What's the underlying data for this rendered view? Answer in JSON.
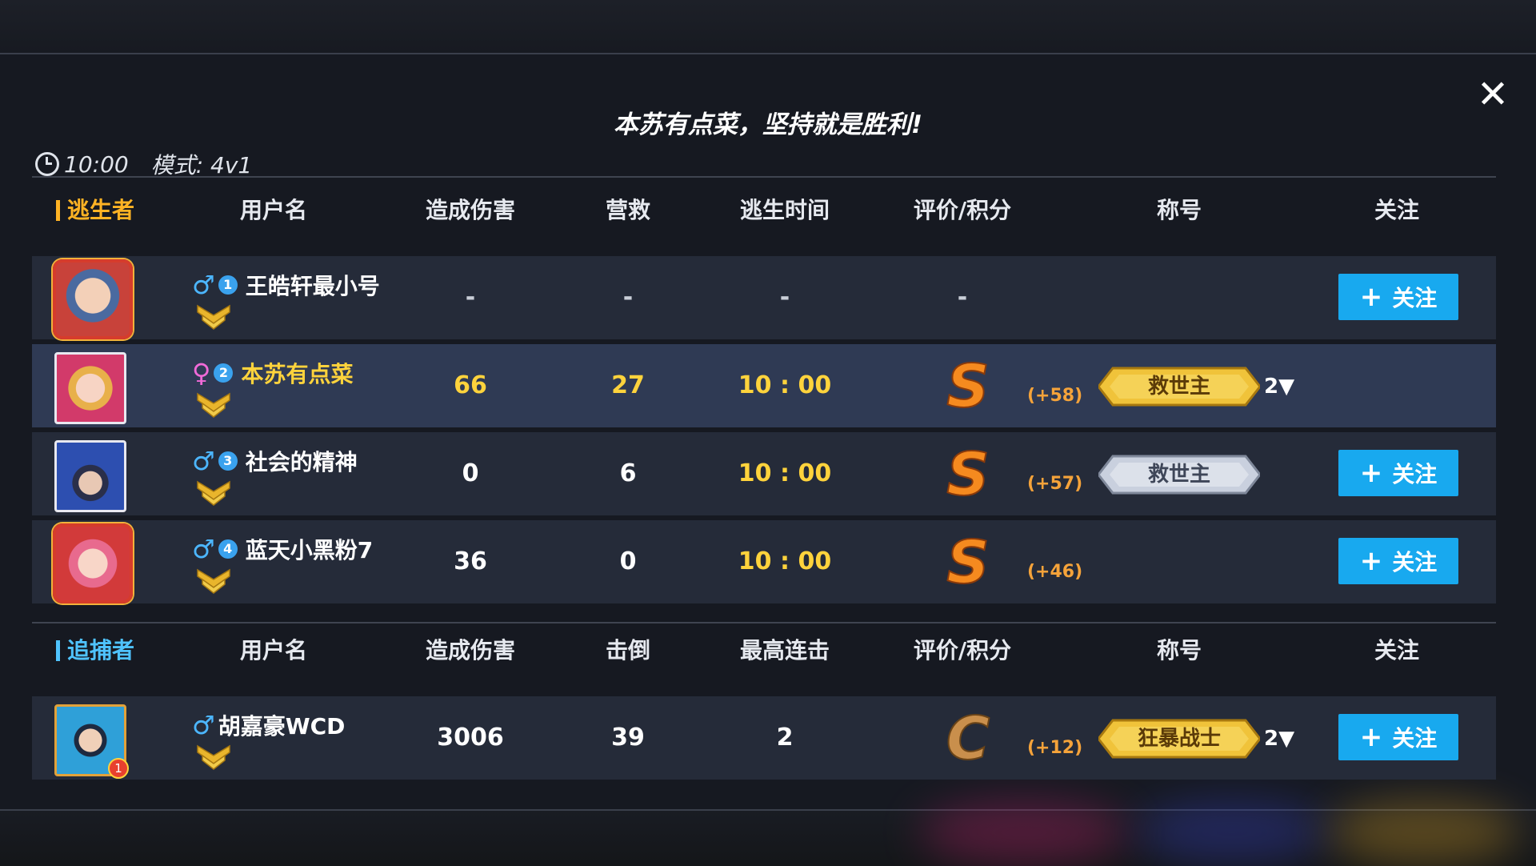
{
  "title": "本苏有点菜，坚持就是胜利!",
  "info": {
    "time": "10:00",
    "mode": "模式: 4v1"
  },
  "close_icon": "close-icon",
  "escapers": {
    "label": "逃生者",
    "headers": {
      "user": "用户名",
      "damage": "造成伤害",
      "rescue": "营救",
      "escape_time": "逃生时间",
      "rating": "评价/积分",
      "title": "称号",
      "follow": "关注"
    },
    "rows": [
      {
        "gender": "♂",
        "rank": "1",
        "name": "王皓轩最小号",
        "damage": "-",
        "rescue": "-",
        "escape_time": "-",
        "grade": "-",
        "points": "",
        "title": "",
        "title_count": "",
        "follow": "关注"
      },
      {
        "gender": "♀",
        "rank": "2",
        "name": "本苏有点菜",
        "damage": "66",
        "rescue": "27",
        "escape_time": "10 : 00",
        "grade": "S",
        "points": "(+58)",
        "title": "救世主",
        "title_count": "2▼",
        "follow": ""
      },
      {
        "gender": "♂",
        "rank": "3",
        "name": "社会的精神",
        "damage": "0",
        "rescue": "6",
        "escape_time": "10 : 00",
        "grade": "S",
        "points": "(+57)",
        "title": "救世主",
        "title_count": "",
        "follow": "关注"
      },
      {
        "gender": "♂",
        "rank": "4",
        "name": "蓝天小黑粉7",
        "damage": "36",
        "rescue": "0",
        "escape_time": "10 : 00",
        "grade": "S",
        "points": "(+46)",
        "title": "",
        "title_count": "",
        "follow": "关注"
      }
    ]
  },
  "chasers": {
    "label": "追捕者",
    "headers": {
      "user": "用户名",
      "damage": "造成伤害",
      "knockdown": "击倒",
      "combo": "最高连击",
      "rating": "评价/积分",
      "title": "称号",
      "follow": "关注"
    },
    "rows": [
      {
        "gender": "♂",
        "name": "胡嘉豪WCD",
        "damage": "3006",
        "knockdown": "39",
        "combo": "2",
        "grade": "C",
        "points": "(+12)",
        "title": "狂暴战士",
        "title_count": "2▼",
        "follow": "关注",
        "avatar_badge": "1"
      }
    ]
  },
  "colors": {
    "escaper_accent": "#ffb324",
    "chaser_accent": "#4fc3ff",
    "follow_button": "#18a9ef",
    "gold_text": "#ffd33c"
  }
}
